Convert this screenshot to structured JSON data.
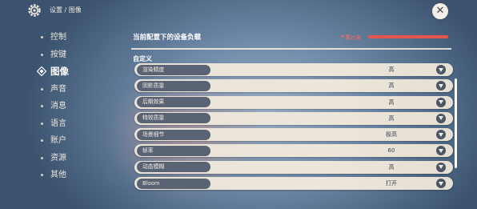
{
  "header": {
    "breadcrumb": "设置 / 图像"
  },
  "sidebar": {
    "items": [
      {
        "label": "控制"
      },
      {
        "label": "按键"
      },
      {
        "label": "图像"
      },
      {
        "label": "声音"
      },
      {
        "label": "消息"
      },
      {
        "label": "语言"
      },
      {
        "label": "账户"
      },
      {
        "label": "资源"
      },
      {
        "label": "其他"
      }
    ]
  },
  "load": {
    "title": "当前配置下的设备负载",
    "status": "严重过高",
    "level": 1.0,
    "color": "#e5554d"
  },
  "section": {
    "title": "自定义"
  },
  "settings": [
    {
      "label": "渲染精度",
      "value": "高"
    },
    {
      "label": "阴影质量",
      "value": "高"
    },
    {
      "label": "后期效果",
      "value": "高"
    },
    {
      "label": "特效质量",
      "value": "高"
    },
    {
      "label": "场景细节",
      "value": "极高"
    },
    {
      "label": "帧率",
      "value": "60"
    },
    {
      "label": "动态模糊",
      "value": "高"
    },
    {
      "label": "Bloom",
      "value": "打开"
    }
  ],
  "icons": {
    "settings": "gear-icon",
    "close": "close-icon",
    "dropdown": "chevron-down-icon",
    "active_nav": "diamond-icon"
  }
}
